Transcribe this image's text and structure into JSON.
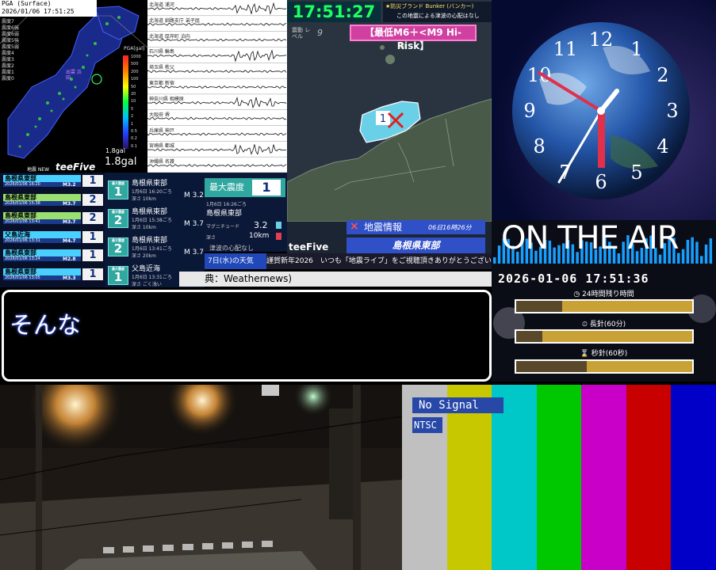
{
  "pga_panel": {
    "header_line1": "PGA (Surface)",
    "header_line2": "2026/01/06 17:51:25",
    "legend": [
      "震度7",
      "震度6強",
      "震度6弱",
      "震度5強",
      "震度5弱",
      "震度4",
      "震度3",
      "震度2",
      "震度1",
      "震度0"
    ],
    "scale_title": "PGA[gal]",
    "scale_labels": [
      "1000",
      "500",
      "200",
      "100",
      "50",
      "20",
      "10",
      "5",
      "2",
      "1",
      "0.5",
      "0.2",
      "0.1"
    ],
    "low_label": "1.8gal",
    "value": "1.8gal",
    "brand": "teeFive",
    "new_label": "地震 NEW",
    "site_label": "出雲 浜田"
  },
  "seismograms": {
    "labels": [
      "北海道 浦河",
      "北海道 釧路支庁 弟子屈",
      "北海道 厚岸町 泊内",
      "石川県 輪島",
      "埼玉県 秩父",
      "東京都 新宿",
      "神奈川県 相模原",
      "大阪府 堺",
      "兵庫県 神戸",
      "宮崎県 都城",
      "沖縄県 名護"
    ]
  },
  "header": {
    "time": "17:51:27",
    "note_line1": "★防災ブランド Bunker (バンカー)",
    "note_line2": "この地震による津波の心配はなし",
    "intensity_label": "震動 レベル",
    "intensity_level": "9",
    "risk_badge": "【最低M6＋<M9 Hi-Risk】"
  },
  "region_map": {
    "epicenter_intensity": "1",
    "info_mark": "×",
    "info_label": "地震情報",
    "info_time": "06日16時26分",
    "region": "島根県東部",
    "brand": "teeFive"
  },
  "history": [
    {
      "place": "島根県東部",
      "date": "2026/01/06 16:20",
      "mag": "M3.2",
      "intensity": "1",
      "color": "#4ad0ff"
    },
    {
      "place": "島根県東部",
      "date": "2026/01/06 15:38",
      "mag": "M3.7",
      "intensity": "2",
      "color": "#9ae070"
    },
    {
      "place": "島根県東部",
      "date": "2026/01/06 13:41",
      "mag": "M3.7",
      "intensity": "2",
      "color": "#9ae070"
    },
    {
      "place": "父島近海",
      "date": "2026/01/06 13:31",
      "mag": "M4.7",
      "intensity": "1",
      "color": "#4ad0ff"
    },
    {
      "place": "島根県東部",
      "date": "2026/01/06 13:24",
      "mag": "M2.8",
      "intensity": "1",
      "color": "#4ad0ff"
    },
    {
      "place": "島根県東部",
      "date": "2026/01/06 13:05",
      "mag": "M3.3",
      "intensity": "1",
      "color": "#4ad0ff"
    }
  ],
  "cards": [
    {
      "badge": "1",
      "badge_label": "最大震度",
      "place": "島根県東部",
      "time": "1月6日 16:20ごろ",
      "depth": "深さ 10km",
      "mag": "M 3.2"
    },
    {
      "badge": "2",
      "badge_label": "最大震度",
      "place": "島根県東部",
      "time": "1月6日 15:38ごろ",
      "depth": "深さ 10km",
      "mag": "M 3.7"
    },
    {
      "badge": "2",
      "badge_label": "最大震度",
      "place": "島根県東部",
      "time": "1月6日 13:41ごろ",
      "depth": "深さ 20km",
      "mag": "M 3.7"
    },
    {
      "badge": "1",
      "badge_label": "最大震度",
      "place": "父島近海",
      "time": "1月6日 13:31ごろ",
      "depth": "深さ ごく浅い",
      "mag": ""
    }
  ],
  "max_panel": {
    "heading": "最大震度",
    "value": "1",
    "time": "1月6日 16:26ごろ",
    "place": "島根県東部",
    "mag_label": "マグニチュード",
    "mag": "3.2",
    "depth_label": "深さ",
    "depth": "10km",
    "tsunami": "津波の心配なし"
  },
  "ticker": {
    "weather_tag": "7日(水)の天気",
    "text": "謹賀新年2026　いつも「地震ライブ」をご視聴頂きありがとうございます!",
    "source": "典：Weathernews)"
  },
  "caption": {
    "text": "そんな"
  },
  "clock": {
    "numerals": [
      "12",
      "1",
      "2",
      "3",
      "4",
      "5",
      "6",
      "7",
      "8",
      "9",
      "10",
      "11"
    ]
  },
  "onair": {
    "title": "ON THE AIR",
    "datetime": "2026-01-06 17:51:36",
    "bars": [
      {
        "label": "◷ 24時間残り時間",
        "fill": 0.26
      },
      {
        "label": "⏲ 長針(60分)",
        "fill": 0.15
      },
      {
        "label": "⌛ 秒針(60秒)",
        "fill": 0.4
      }
    ]
  },
  "signal": {
    "no_signal": "No Signal",
    "standard": "NTSC",
    "colors": [
      "#c0c0c0",
      "#c8c800",
      "#00c8c8",
      "#00c800",
      "#c800c8",
      "#c80000",
      "#0000c8"
    ]
  }
}
